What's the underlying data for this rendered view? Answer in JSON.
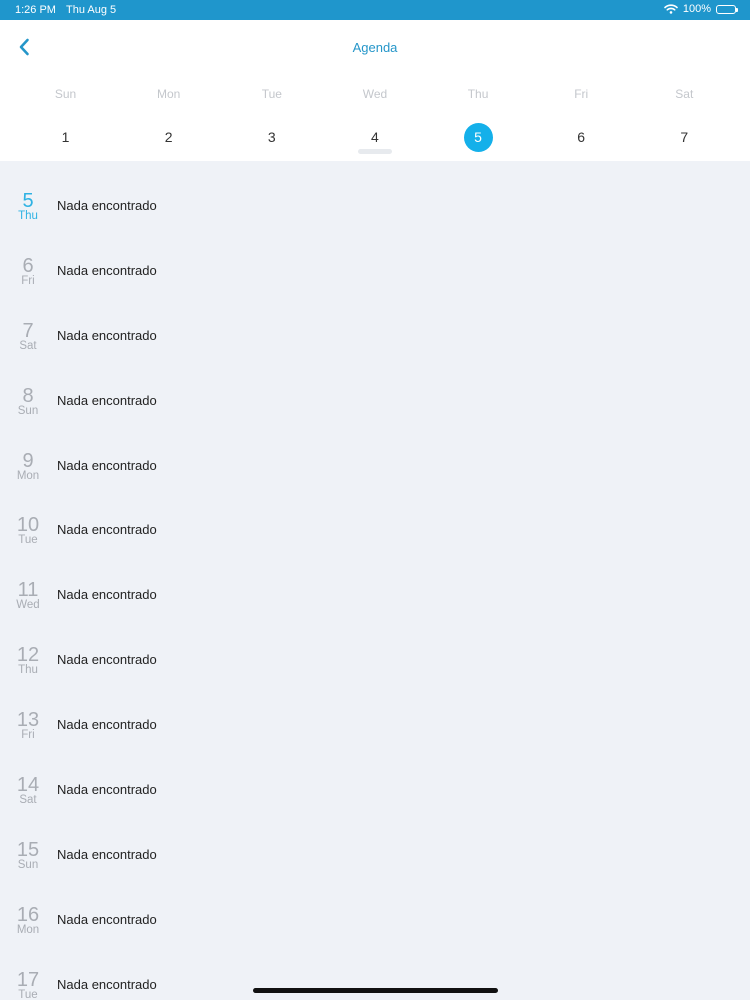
{
  "status_bar": {
    "time": "1:26 PM",
    "date": "Thu Aug 5",
    "battery": "100%",
    "wifi_icon": "wifi-icon",
    "battery_icon": "battery-icon"
  },
  "header": {
    "title": "Agenda",
    "back_icon": "chevron-left-icon",
    "accent_color": "#2596c9"
  },
  "week": [
    {
      "name": "Sun",
      "num": "1"
    },
    {
      "name": "Mon",
      "num": "2"
    },
    {
      "name": "Tue",
      "num": "3"
    },
    {
      "name": "Wed",
      "num": "4"
    },
    {
      "name": "Thu",
      "num": "5",
      "selected": true
    },
    {
      "name": "Fri",
      "num": "6"
    },
    {
      "name": "Sat",
      "num": "7"
    }
  ],
  "agenda": [
    {
      "num": "5",
      "day": "Thu",
      "text": "Nada encontrado",
      "today": true
    },
    {
      "num": "6",
      "day": "Fri",
      "text": "Nada encontrado"
    },
    {
      "num": "7",
      "day": "Sat",
      "text": "Nada encontrado"
    },
    {
      "num": "8",
      "day": "Sun",
      "text": "Nada encontrado"
    },
    {
      "num": "9",
      "day": "Mon",
      "text": "Nada encontrado"
    },
    {
      "num": "10",
      "day": "Tue",
      "text": "Nada encontrado"
    },
    {
      "num": "11",
      "day": "Wed",
      "text": "Nada encontrado"
    },
    {
      "num": "12",
      "day": "Thu",
      "text": "Nada encontrado"
    },
    {
      "num": "13",
      "day": "Fri",
      "text": "Nada encontrado"
    },
    {
      "num": "14",
      "day": "Sat",
      "text": "Nada encontrado"
    },
    {
      "num": "15",
      "day": "Sun",
      "text": "Nada encontrado"
    },
    {
      "num": "16",
      "day": "Mon",
      "text": "Nada encontrado"
    },
    {
      "num": "17",
      "day": "Tue",
      "text": "Nada encontrado"
    }
  ],
  "colors": {
    "status_bar": "#1f96cc",
    "selected_day": "#14b0ea",
    "today_date": "#2eb2e3",
    "background": "#eff2f7"
  }
}
